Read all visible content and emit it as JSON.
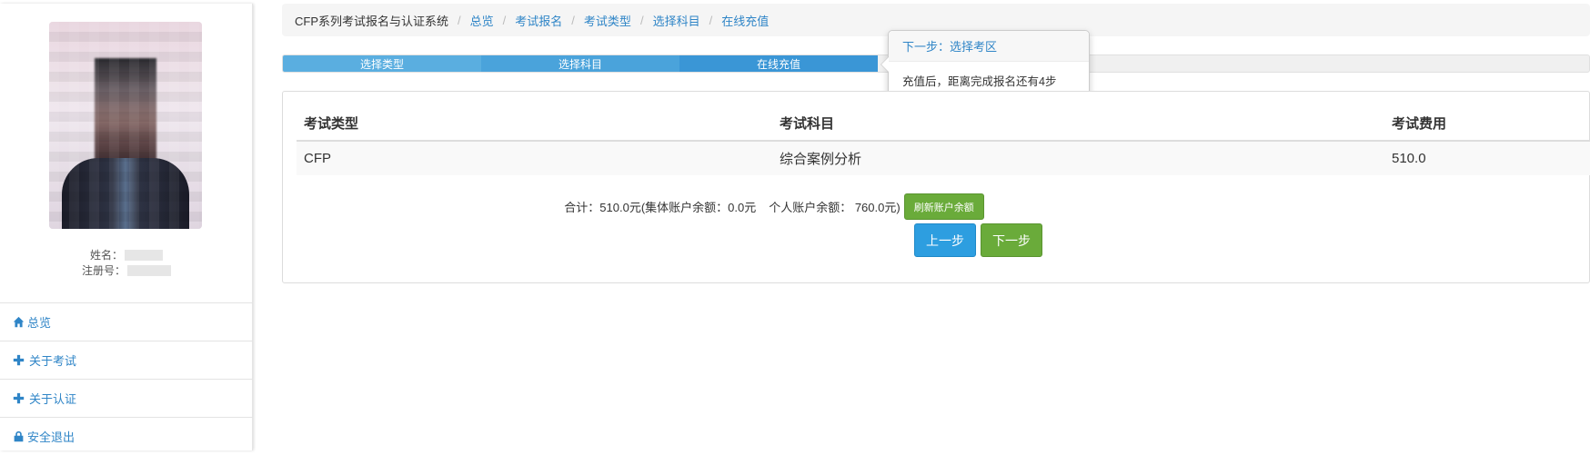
{
  "sidebar": {
    "profile": {
      "name_label": "姓名：",
      "reg_label": "注册号："
    },
    "nav": [
      {
        "label": "总览",
        "icon": "home-icon"
      },
      {
        "label": "关于考试",
        "icon": "plus-icon"
      },
      {
        "label": "关于认证",
        "icon": "plus-icon"
      },
      {
        "label": "安全退出",
        "icon": "lock-icon"
      }
    ]
  },
  "breadcrumb": {
    "root": "CFP系列考试报名与认证系统",
    "items": [
      "总览",
      "考试报名",
      "考试类型",
      "选择科目",
      "在线充值"
    ]
  },
  "steps": [
    "选择类型",
    "选择科目",
    "在线充值"
  ],
  "popover": {
    "title": "下一步：选择考区",
    "content": "充值后，距离完成报名还有4步"
  },
  "table": {
    "headers": [
      "考试类型",
      "考试科目",
      "考试费用"
    ],
    "rows": [
      [
        "CFP",
        "综合案例分析",
        "510.0"
      ]
    ]
  },
  "summary": {
    "total": "合计：510.0元(集体账户余额：0.0元",
    "personal": "个人账户余额： 760.0元)",
    "refresh_label": "刷新账户余额"
  },
  "buttons": {
    "prev_label": "上一步",
    "next_label": "下一步"
  },
  "colors": {
    "link": "#2f85c7",
    "primary": "#2d9ee0",
    "success": "#6aab3a"
  }
}
